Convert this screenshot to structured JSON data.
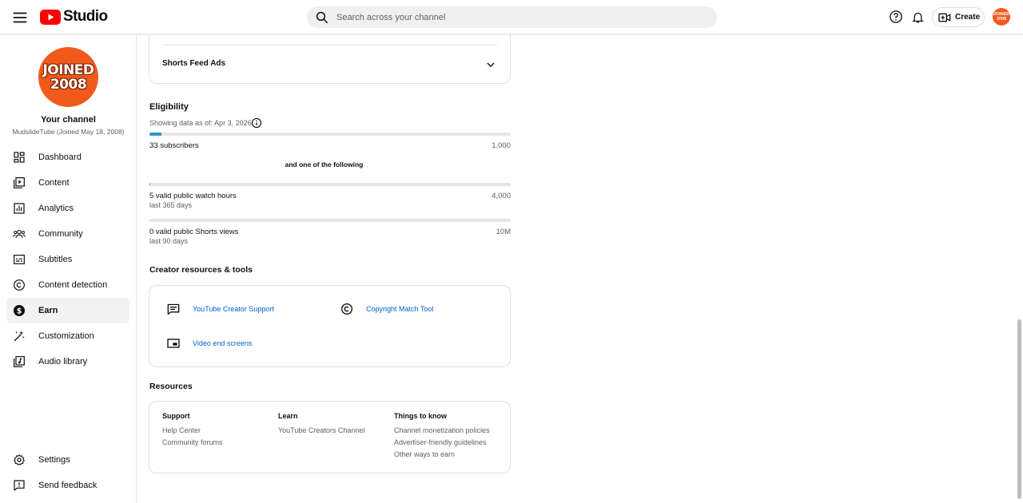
{
  "header": {
    "logo_text": "Studio",
    "search_placeholder": "Search across your channel",
    "create_label": "Create",
    "avatar_text_line1": "JOINED",
    "avatar_text_line2": "2008"
  },
  "sidebar": {
    "avatar_line1": "JOINED",
    "avatar_line2": "2008",
    "channel_title": "Your channel",
    "channel_subtitle": "MudslideTube (Joined May 18, 2008)",
    "items": [
      {
        "label": "Dashboard",
        "icon": "dashboard-icon"
      },
      {
        "label": "Content",
        "icon": "content-icon"
      },
      {
        "label": "Analytics",
        "icon": "analytics-icon"
      },
      {
        "label": "Community",
        "icon": "community-icon"
      },
      {
        "label": "Subtitles",
        "icon": "subtitles-icon"
      },
      {
        "label": "Content detection",
        "icon": "copyright-icon"
      },
      {
        "label": "Earn",
        "icon": "dollar-icon",
        "active": true
      },
      {
        "label": "Customization",
        "icon": "magic-wand-icon"
      },
      {
        "label": "Audio library",
        "icon": "audio-library-icon"
      }
    ],
    "bottom_items": [
      {
        "label": "Settings",
        "icon": "gear-icon"
      },
      {
        "label": "Send feedback",
        "icon": "feedback-icon"
      }
    ]
  },
  "main": {
    "shorts_feed_ads": "Shorts Feed Ads",
    "eligibility": {
      "title": "Eligibility",
      "showing_data": "Showing data as of: Apr 3, 2026",
      "subscribers": {
        "label": "33 subscribers",
        "goal": "1,000",
        "progress": 0.033
      },
      "and_one_of": "and one of the following",
      "watch_hours": {
        "label": "5 valid public watch hours",
        "sub": "last 365 days",
        "goal": "4,000",
        "progress": 0.00125
      },
      "shorts_views": {
        "label": "0 valid public Shorts views",
        "sub": "last 90 days",
        "goal": "10M",
        "progress": 0
      }
    },
    "creator_tools": {
      "title": "Creator resources & tools",
      "items": [
        {
          "label": "YouTube Creator Support",
          "icon": "message-icon"
        },
        {
          "label": "Copyright Match Tool",
          "icon": "copyright-icon"
        },
        {
          "label": "Video end screens",
          "icon": "end-screen-icon"
        }
      ]
    },
    "resources": {
      "title": "Resources",
      "columns": [
        {
          "heading": "Support",
          "links": [
            "Help Center",
            "Community forums"
          ]
        },
        {
          "heading": "Learn",
          "links": [
            "YouTube Creators Channel"
          ]
        },
        {
          "heading": "Things to know",
          "links": [
            "Channel monetization policies",
            "Advertiser-friendly guidelines",
            "Other ways to earn"
          ]
        }
      ]
    }
  },
  "colors": {
    "accent_red": "#ff0000",
    "avatar_orange": "#f15a1a",
    "progress_blue": "#2f94c5",
    "link_blue": "#065fd4"
  }
}
